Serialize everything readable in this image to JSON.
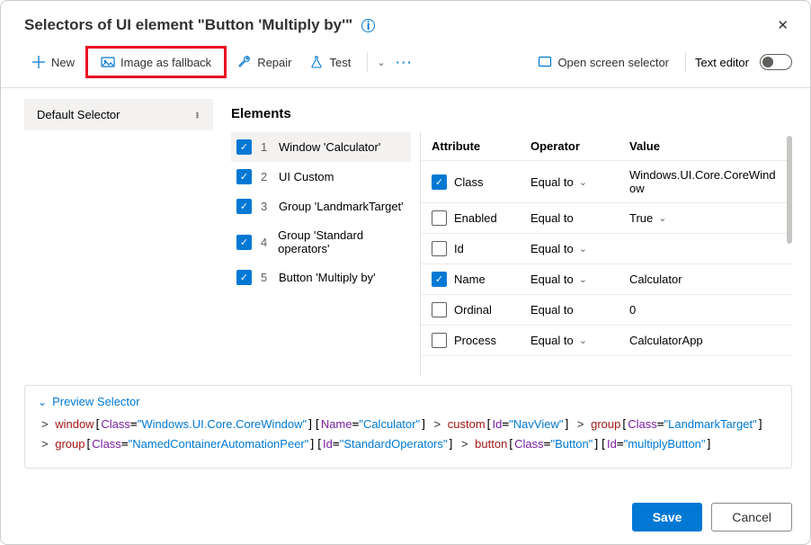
{
  "header": {
    "title": "Selectors of UI element \"Button 'Multiply by'\""
  },
  "toolbar": {
    "new": "New",
    "image_fallback": "Image as fallback",
    "repair": "Repair",
    "test": "Test",
    "open_screen": "Open screen selector",
    "text_editor": "Text editor"
  },
  "sidebar": {
    "default_selector": "Default Selector"
  },
  "main": {
    "title": "Elements",
    "elements": [
      {
        "idx": "1",
        "label": "Window 'Calculator'",
        "checked": true,
        "selected": true
      },
      {
        "idx": "2",
        "label": "UI Custom",
        "checked": true,
        "selected": false
      },
      {
        "idx": "3",
        "label": "Group 'LandmarkTarget'",
        "checked": true,
        "selected": false
      },
      {
        "idx": "4",
        "label": "Group 'Standard operators'",
        "checked": true,
        "selected": false
      },
      {
        "idx": "5",
        "label": "Button 'Multiply by'",
        "checked": true,
        "selected": false
      }
    ],
    "attr_headers": {
      "attribute": "Attribute",
      "operator": "Operator",
      "value": "Value"
    },
    "attributes": [
      {
        "name": "Class",
        "checked": true,
        "op": "Equal to",
        "chev": true,
        "value": "Windows.UI.Core.CoreWindow",
        "vchev": false
      },
      {
        "name": "Enabled",
        "checked": false,
        "op": "Equal to",
        "chev": false,
        "value": "True",
        "vchev": true
      },
      {
        "name": "Id",
        "checked": false,
        "op": "Equal to",
        "chev": true,
        "value": "",
        "vchev": false
      },
      {
        "name": "Name",
        "checked": true,
        "op": "Equal to",
        "chev": true,
        "value": "Calculator",
        "vchev": false
      },
      {
        "name": "Ordinal",
        "checked": false,
        "op": "Equal to",
        "chev": false,
        "value": "0",
        "vchev": false
      },
      {
        "name": "Process",
        "checked": false,
        "op": "Equal to",
        "chev": true,
        "value": "CalculatorApp",
        "vchev": false
      }
    ]
  },
  "preview": {
    "label": "Preview Selector",
    "parts": [
      {
        "gt": "> ",
        "tag": "window",
        "pairs": [
          [
            "Class",
            "Windows.UI.Core.CoreWindow"
          ],
          [
            "Name",
            "Calculator"
          ]
        ]
      },
      {
        "gt": " > ",
        "tag": "custom",
        "pairs": [
          [
            "Id",
            "NavView"
          ]
        ]
      },
      {
        "gt": " > ",
        "tag": "group",
        "pairs": [
          [
            "Class",
            "LandmarkTarget"
          ]
        ]
      },
      {
        "br": true
      },
      {
        "gt": "> ",
        "tag": "group",
        "pairs": [
          [
            "Class",
            "NamedContainerAutomationPeer"
          ],
          [
            "Id",
            "StandardOperators"
          ]
        ]
      },
      {
        "gt": " > ",
        "tag": "button",
        "pairs": [
          [
            "Class",
            "Button"
          ],
          [
            "Id",
            "multiplyButton"
          ]
        ]
      }
    ]
  },
  "footer": {
    "save": "Save",
    "cancel": "Cancel"
  }
}
